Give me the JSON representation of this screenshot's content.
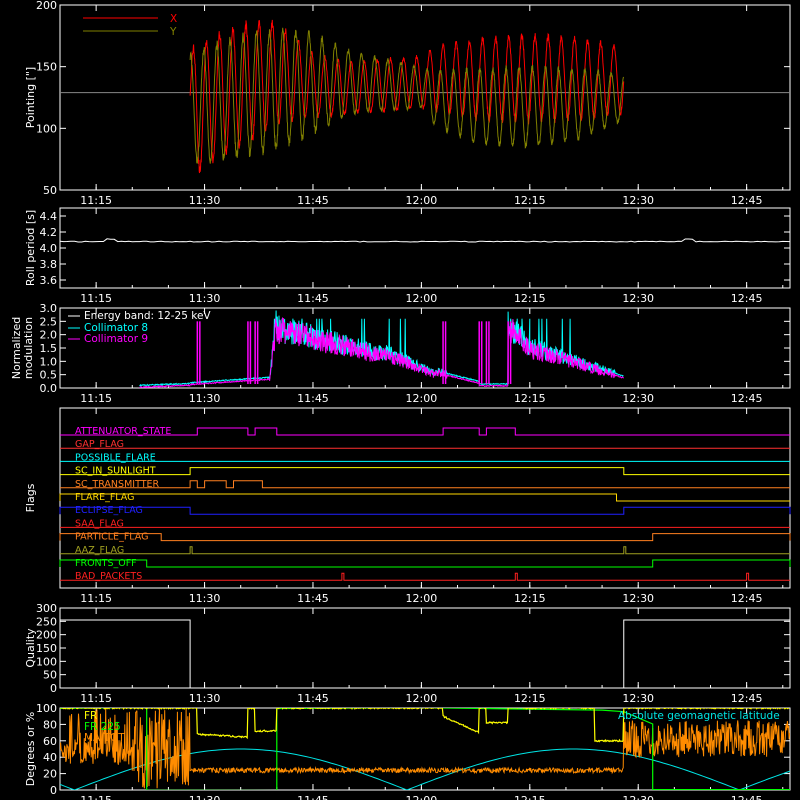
{
  "chart_data": [
    {
      "id": "pointing",
      "type": "line",
      "ylabel": "Pointing [\"]",
      "ylim": [
        50,
        200
      ],
      "yticks": [
        50,
        100,
        150,
        200
      ],
      "xlim": [
        "11:10",
        "12:51"
      ],
      "xticks": [
        "11:15",
        "11:30",
        "11:45",
        "12:00",
        "12:15",
        "12:30",
        "12:45"
      ],
      "reference_line": 129,
      "series": [
        {
          "name": "X",
          "color": "#ff0000",
          "envelope": [
            [
              "11:28",
              88,
              165
            ],
            [
              "11:29",
              60,
              172
            ],
            [
              "11:33",
              78,
              183
            ],
            [
              "11:37",
              88,
              190
            ],
            [
              "11:40",
              100,
              188
            ],
            [
              "11:45",
              108,
              162
            ],
            [
              "11:50",
              110,
              155
            ],
            [
              "12:00",
              115,
              160
            ],
            [
              "12:02",
              112,
              168
            ],
            [
              "12:08",
              105,
              175
            ],
            [
              "12:15",
              103,
              178
            ],
            [
              "12:22",
              105,
              175
            ],
            [
              "12:28",
              110,
              168
            ]
          ]
        },
        {
          "name": "Y",
          "color": "#808000",
          "envelope": [
            [
              "11:28",
              70,
              162
            ],
            [
              "11:31",
              70,
              170
            ],
            [
              "11:36",
              76,
              180
            ],
            [
              "11:40",
              80,
              183
            ],
            [
              "11:44",
              90,
              182
            ],
            [
              "11:50",
              110,
              165
            ],
            [
              "12:00",
              116,
              150
            ],
            [
              "12:02",
              100,
              148
            ],
            [
              "12:08",
              85,
              150
            ],
            [
              "12:15",
              83,
              152
            ],
            [
              "12:22",
              90,
              150
            ],
            [
              "12:28",
              105,
              145
            ]
          ]
        }
      ]
    },
    {
      "id": "roll",
      "type": "line",
      "ylabel": "Roll period [s]",
      "ylim": [
        3.5,
        4.5
      ],
      "yticks": [
        3.6,
        3.8,
        4.0,
        4.2,
        4.4
      ],
      "xlim": [
        "11:10",
        "12:51"
      ],
      "xticks": [
        "11:15",
        "11:30",
        "11:45",
        "12:00",
        "12:15",
        "12:30",
        "12:45"
      ],
      "series": [
        {
          "name": "Roll period",
          "color": "#ffffff",
          "value": 4.08
        }
      ]
    },
    {
      "id": "modulation",
      "type": "line",
      "ylabel": [
        "Normalized",
        "modulation"
      ],
      "ylim": [
        0.0,
        3.0
      ],
      "yticks": [
        0.0,
        0.5,
        1.0,
        1.5,
        2.0,
        2.5,
        3.0
      ],
      "xlim": [
        "11:10",
        "12:51"
      ],
      "xticks": [
        "11:15",
        "11:30",
        "11:45",
        "12:00",
        "12:15",
        "12:30",
        "12:45"
      ],
      "annotation": "Energy band: 12-25 keV",
      "series": [
        {
          "name": "Collimator 8",
          "color": "#00ffff"
        },
        {
          "name": "Collimator 9",
          "color": "#ff00ff"
        }
      ],
      "segments": [
        [
          "11:21",
          "11:28",
          0.05,
          0.12
        ],
        [
          "11:28",
          "11:39",
          0.15,
          0.35
        ],
        [
          "11:39",
          "11:40",
          0.3,
          2.6
        ],
        [
          "11:40",
          "11:55",
          2.2,
          1.2
        ],
        [
          "11:55",
          "12:02",
          1.3,
          0.5
        ],
        [
          "12:02",
          "12:08",
          0.6,
          0.2
        ],
        [
          "12:08",
          "12:12",
          0.1,
          0.1
        ],
        [
          "12:12",
          "12:15",
          2.3,
          1.5
        ],
        [
          "12:15",
          "12:28",
          1.5,
          0.4
        ]
      ],
      "spikes": [
        [
          "11:29",
          2.5
        ],
        [
          "11:36",
          2.5
        ],
        [
          "11:37",
          2.5
        ],
        [
          "12:08",
          2.5
        ],
        [
          "12:09",
          2.5
        ],
        [
          "12:12",
          2.5
        ],
        [
          "12:03",
          2.5
        ]
      ]
    },
    {
      "id": "flags",
      "type": "line",
      "ylabel": "Flags",
      "xlim": [
        "11:10",
        "12:51"
      ],
      "xticks": [
        "11:15",
        "11:30",
        "11:45",
        "12:00",
        "12:15",
        "12:30",
        "12:45"
      ],
      "series": [
        {
          "name": "ATTENUATOR_STATE",
          "color": "#ff00ff",
          "high": [
            [
              "11:29",
              "11:36"
            ],
            [
              "11:37",
              "11:40"
            ],
            [
              "12:03",
              "12:08"
            ],
            [
              "12:09",
              "12:13"
            ]
          ]
        },
        {
          "name": "GAP_FLAG",
          "color": "#ff3030",
          "high": []
        },
        {
          "name": "POSSIBLE_FLARE",
          "color": "#00ffff",
          "high": []
        },
        {
          "name": "SC_IN_SUNLIGHT",
          "color": "#ffff00",
          "high": [
            [
              "11:28",
              "12:28"
            ]
          ]
        },
        {
          "name": "SC_TRANSMITTER",
          "color": "#ff8020",
          "high": [
            [
              "11:28",
              "11:29"
            ],
            [
              "11:30",
              "11:33"
            ],
            [
              "11:34",
              "11:38"
            ]
          ]
        },
        {
          "name": "FLARE_FLAG",
          "color": "#ffd700",
          "high": [
            [
              "11:10",
              "12:27"
            ]
          ]
        },
        {
          "name": "ECLIPSE_FLAG",
          "color": "#2020ff",
          "high": [
            [
              "11:10",
              "11:28"
            ],
            [
              "12:28",
              "12:51"
            ]
          ]
        },
        {
          "name": "SAA_FLAG",
          "color": "#ff2020",
          "high": []
        },
        {
          "name": "PARTICLE_FLAG",
          "color": "#ff8020",
          "high": [
            [
              "11:10",
              "11:24"
            ],
            [
              "12:32",
              "12:51"
            ]
          ]
        },
        {
          "name": "AAZ_FLAG",
          "color": "#a0a020",
          "high": [
            [
              "11:28",
              "11:28"
            ],
            [
              "12:28",
              "12:28"
            ]
          ]
        },
        {
          "name": "FRONTS_OFF",
          "color": "#00ff00",
          "high": [
            [
              "11:10",
              "11:22"
            ],
            [
              "12:32",
              "12:51"
            ]
          ]
        },
        {
          "name": "BAD_PACKETS",
          "color": "#ff2020",
          "high": [
            [
              "11:49",
              "11:49"
            ],
            [
              "12:13",
              "12:13"
            ],
            [
              "12:45",
              "12:45"
            ]
          ]
        }
      ]
    },
    {
      "id": "quality",
      "type": "line",
      "ylabel": "Quality",
      "ylim": [
        0,
        300
      ],
      "yticks": [
        0,
        50,
        100,
        150,
        200,
        250,
        300
      ],
      "xlim": [
        "11:10",
        "12:51"
      ],
      "xticks": [
        "11:15",
        "11:30",
        "11:45",
        "12:00",
        "12:15",
        "12:30",
        "12:45"
      ],
      "series": [
        {
          "name": "Quality",
          "color": "#ffffff",
          "steps": [
            [
              "11:10",
              255
            ],
            [
              "11:28",
              0
            ],
            [
              "12:28",
              255
            ],
            [
              "12:51",
              255
            ]
          ]
        }
      ]
    },
    {
      "id": "degrees",
      "type": "line",
      "ylabel": "Degrees or %",
      "ylim": [
        0,
        100
      ],
      "yticks": [
        0,
        20,
        40,
        60,
        80,
        100
      ],
      "xlim": [
        "11:10",
        "12:51"
      ],
      "xticks": [
        "11:15",
        "11:30",
        "11:45",
        "12:00",
        "12:15",
        "12:30",
        "12:45"
      ],
      "series": [
        {
          "name": "FR",
          "color": "#ffff00",
          "legend_text": "FR"
        },
        {
          "name": "FR_225",
          "color": "#00ff00",
          "legend_text": "FR 225"
        },
        {
          "name": "MA_TOT",
          "color": "#ff8c00",
          "legend_text": "MA TOT"
        },
        {
          "name": "Absolute geomagnetic latitude",
          "color": "#00e5e5",
          "legend_text": "Absolute geomagnetic latitude"
        }
      ]
    }
  ]
}
